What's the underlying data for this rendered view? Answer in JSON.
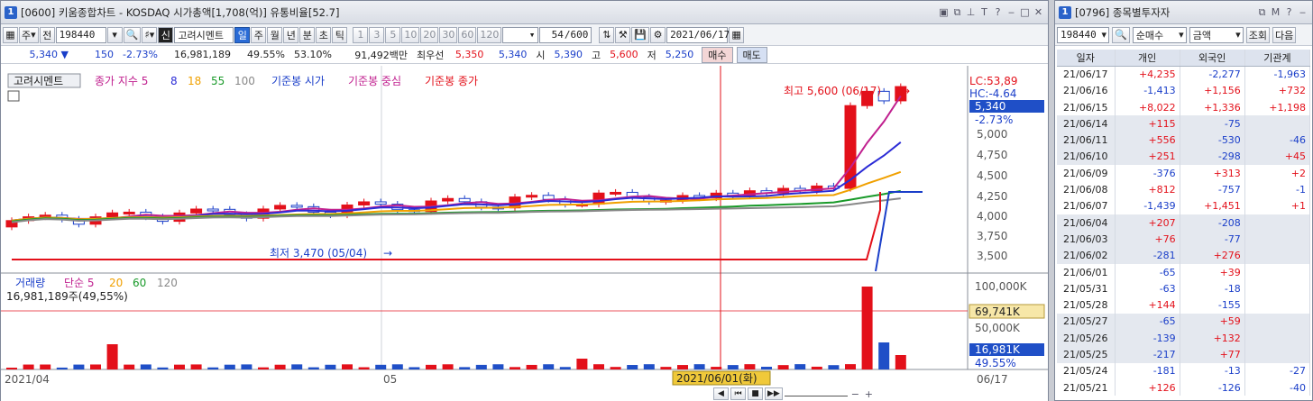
{
  "chart_window": {
    "number": "1",
    "title": "[0600] 키움종합차트 - KOSDAQ 시가총액[1,708(억)] 유통비율[52.7]",
    "toolbar": {
      "period_unit": "주",
      "prev_label": "전",
      "code": "198440",
      "stock_name": "고려시멘트",
      "period_buttons": [
        "일",
        "주",
        "월",
        "년",
        "분",
        "초",
        "틱"
      ],
      "active_period": "일",
      "interval_buttons": [
        "1",
        "3",
        "5",
        "10",
        "20",
        "30",
        "60",
        "120"
      ],
      "count": "54",
      "count_total": "/600",
      "date": "2021/06/17"
    },
    "quote": {
      "price": "5,340",
      "change": "150",
      "change_pct": "-2.73%",
      "volume": "16,981,189",
      "vol_ratio": "49.55%",
      "float_ratio": "53.10%",
      "amount": "91,492백만",
      "pref_label": "최우선",
      "ask": "5,350",
      "bid": "5,340",
      "open_label": "시",
      "open": "5,390",
      "high_label": "고",
      "high": "5,600",
      "low_label": "저",
      "low": "5,250",
      "buy_label": "매수",
      "sell_label": "매도"
    },
    "legend": {
      "stock_tag": "고려시멘트",
      "close_label": "종가 지수 5",
      "ma_values": [
        "8",
        "18",
        "55",
        "100"
      ],
      "ma_colors": [
        "#2b2bd6",
        "#f0a000",
        "#1a9a2a",
        "#888888"
      ],
      "ref_close": "기준봉 시가",
      "ref_mid": "기준봉 중심",
      "ref_last": "기준봉 종가"
    },
    "annotations": {
      "max_label": "최고 5,600 (06/17)",
      "min_label": "최저 3,470 (05/04)",
      "lc": "LC:53,89",
      "hc": "HC:-4.64",
      "current_price": "5,340",
      "current_pct": "-2.73%"
    },
    "price_axis": [
      "5,000",
      "4,750",
      "4,500",
      "4,250",
      "4,000",
      "3,750",
      "3,500"
    ],
    "volume_legend": {
      "label": "거래량",
      "ma_label": "단순 5",
      "ma_values": [
        "20",
        "60",
        "120"
      ],
      "summary": "16,981,189주(49,55%)"
    },
    "volume_axis": [
      "100,000K",
      "50,000K"
    ],
    "volume_tags": {
      "ma_value": "69,741K",
      "volume": "16,981K",
      "pct": "49.55%"
    },
    "x_axis": {
      "start": "2021/04",
      "month": "05",
      "cursor": "2021/06/01(화)",
      "end": "06/17"
    }
  },
  "investor_window": {
    "number": "1",
    "title": "[0796] 종목별투자자",
    "controls": {
      "code": "198440",
      "mode": "순매수",
      "unit": "금액",
      "query_label": "조회",
      "next_label": "다음"
    },
    "columns": [
      "일자",
      "개인",
      "외국인",
      "기관계"
    ],
    "rows": [
      {
        "date": "21/06/17",
        "indiv": "+4,235",
        "foreign": "-2,277",
        "inst": "-1,963"
      },
      {
        "date": "21/06/16",
        "indiv": "-1,413",
        "foreign": "+1,156",
        "inst": "+732"
      },
      {
        "date": "21/06/15",
        "indiv": "+8,022",
        "foreign": "+1,336",
        "inst": "+1,198"
      },
      {
        "date": "21/06/14",
        "indiv": "+115",
        "foreign": "-75",
        "inst": ""
      },
      {
        "date": "21/06/11",
        "indiv": "+556",
        "foreign": "-530",
        "inst": "-46"
      },
      {
        "date": "21/06/10",
        "indiv": "+251",
        "foreign": "-298",
        "inst": "+45"
      },
      {
        "date": "21/06/09",
        "indiv": "-376",
        "foreign": "+313",
        "inst": "+2"
      },
      {
        "date": "21/06/08",
        "indiv": "+812",
        "foreign": "-757",
        "inst": "-1"
      },
      {
        "date": "21/06/07",
        "indiv": "-1,439",
        "foreign": "+1,451",
        "inst": "+1"
      },
      {
        "date": "21/06/04",
        "indiv": "+207",
        "foreign": "-208",
        "inst": ""
      },
      {
        "date": "21/06/03",
        "indiv": "+76",
        "foreign": "-77",
        "inst": ""
      },
      {
        "date": "21/06/02",
        "indiv": "-281",
        "foreign": "+276",
        "inst": ""
      },
      {
        "date": "21/06/01",
        "indiv": "-65",
        "foreign": "+39",
        "inst": ""
      },
      {
        "date": "21/05/31",
        "indiv": "-63",
        "foreign": "-18",
        "inst": ""
      },
      {
        "date": "21/05/28",
        "indiv": "+144",
        "foreign": "-155",
        "inst": ""
      },
      {
        "date": "21/05/27",
        "indiv": "-65",
        "foreign": "+59",
        "inst": ""
      },
      {
        "date": "21/05/26",
        "indiv": "-139",
        "foreign": "+132",
        "inst": ""
      },
      {
        "date": "21/05/25",
        "indiv": "-217",
        "foreign": "+77",
        "inst": ""
      },
      {
        "date": "21/05/24",
        "indiv": "-181",
        "foreign": "-13",
        "inst": "-27"
      },
      {
        "date": "21/05/21",
        "indiv": "+126",
        "foreign": "-126",
        "inst": "-40"
      }
    ]
  },
  "chart_data": {
    "type": "line",
    "x": [
      "2021/04",
      "05",
      "2021/06/01",
      "06/17"
    ],
    "series": [],
    "ylim": [
      3300,
      5700
    ]
  }
}
